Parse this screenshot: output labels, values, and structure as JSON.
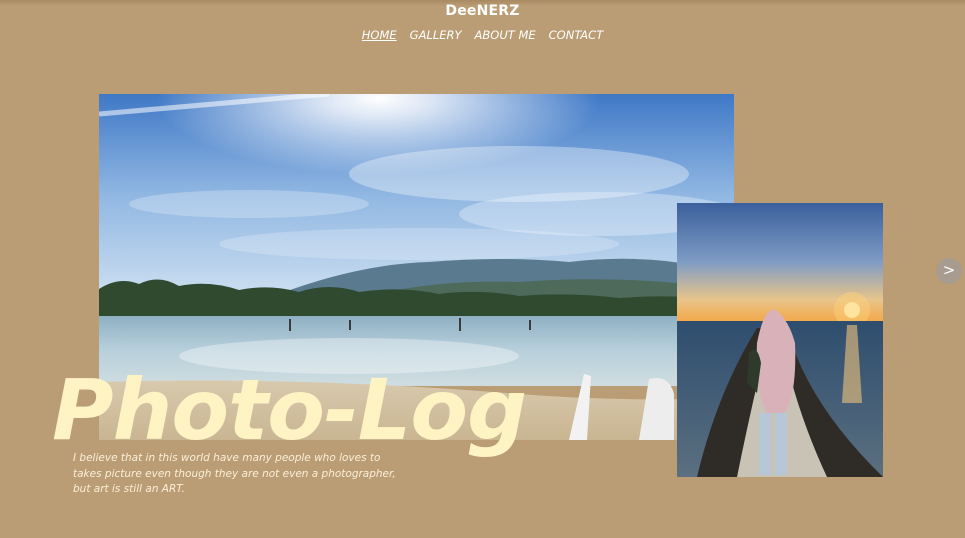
{
  "brand": {
    "name": "DeeNERZ"
  },
  "nav": {
    "items": [
      {
        "label": "HOME",
        "active": true
      },
      {
        "label": "GALLERY",
        "active": false
      },
      {
        "label": "ABOUT ME",
        "active": false
      },
      {
        "label": "CONTACT",
        "active": false
      }
    ]
  },
  "hero": {
    "title": "Photo-Log",
    "tagline_lines": [
      "I believe that in this world have many people who loves to",
      "takes picture even though they are not even a photographer,",
      "but art is still an ART."
    ]
  },
  "slider": {
    "next_label": ">"
  },
  "colors": {
    "background": "#bb9d75",
    "title": "#fef3c3",
    "text": "#ffffff",
    "next_button": "#a89b8f"
  },
  "icons": {
    "next": "chevron-right-icon"
  }
}
